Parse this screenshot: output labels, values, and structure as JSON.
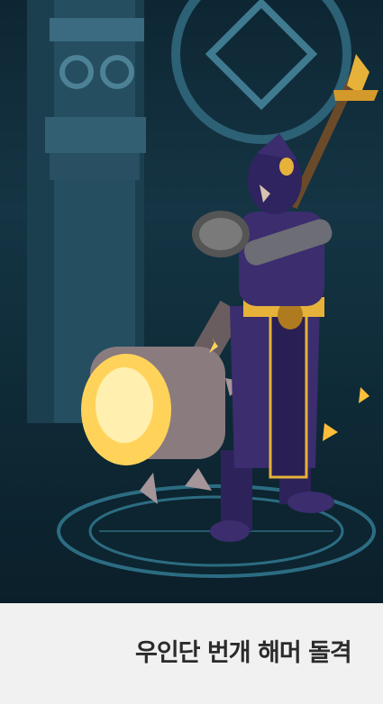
{
  "caption": {
    "title": "우인단 번개 해머 돌격"
  },
  "colors": {
    "background_dark": "#0f2c39",
    "armor_purple": "#3b2d6e",
    "gold_trim": "#e6b23a",
    "hammer_glow": "#ffd35a",
    "caption_bg": "#f1f1f1",
    "caption_text": "#2b2b2b"
  }
}
